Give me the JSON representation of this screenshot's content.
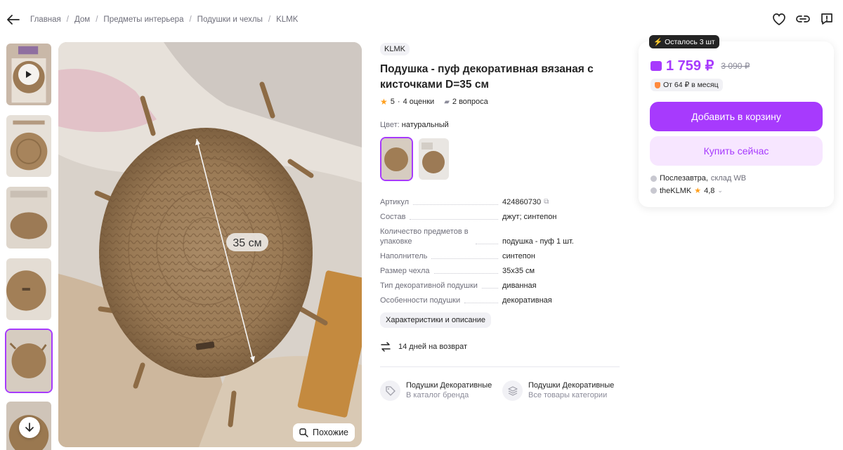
{
  "breadcrumb": [
    "Главная",
    "Дом",
    "Предметы интерьера",
    "Подушки и чехлы",
    "KLMK"
  ],
  "breadcrumb_sep": "/",
  "similar_label": "Похожие",
  "image_text": "35 см",
  "product": {
    "brand": "KLMK",
    "title": "Подушка - пуф декоративная вязаная с кисточками D=35 см",
    "rating": "5",
    "reviews": "4 оценки",
    "questions": "2 вопроса",
    "color_label": "Цвет:",
    "color_value": "натуральный"
  },
  "specs": [
    {
      "name": "Артикул",
      "value": "424860730"
    },
    {
      "name": "Состав",
      "value": "джут; синтепон"
    },
    {
      "name": "Количество предметов в упаковке",
      "value": "подушка - пуф 1 шт."
    },
    {
      "name": "Наполнитель",
      "value": "синтепон"
    },
    {
      "name": "Размер чехла",
      "value": "35х35 см"
    },
    {
      "name": "Тип декоративной подушки",
      "value": "диванная"
    },
    {
      "name": "Особенности подушки",
      "value": "декоративная"
    }
  ],
  "char_button": "Характеристики и описание",
  "return_text": "14 дней на возврат",
  "category_links": [
    {
      "title": "Подушки Декоративные",
      "subtitle": "В каталог бренда"
    },
    {
      "title": "Подушки Декоративные",
      "subtitle": "Все товары категории"
    }
  ],
  "buy_card": {
    "stock_badge": "Осталось 3 шт",
    "price": "1 759 ₽",
    "old_price": "3 090 ₽",
    "installment": "От 64 ₽ в месяц",
    "add_to_cart": "Добавить в корзину",
    "buy_now": "Купить сейчас",
    "delivery_day": "Послезавтра,",
    "delivery_source": "склад WB",
    "seller_name": "theKLMK",
    "seller_rating": "4,8"
  },
  "colors": {
    "accent": "#a73afd",
    "accent_light": "#f7e6ff",
    "star": "#ff9f1c",
    "text": "#242424",
    "muted": "#6e6e7a"
  }
}
